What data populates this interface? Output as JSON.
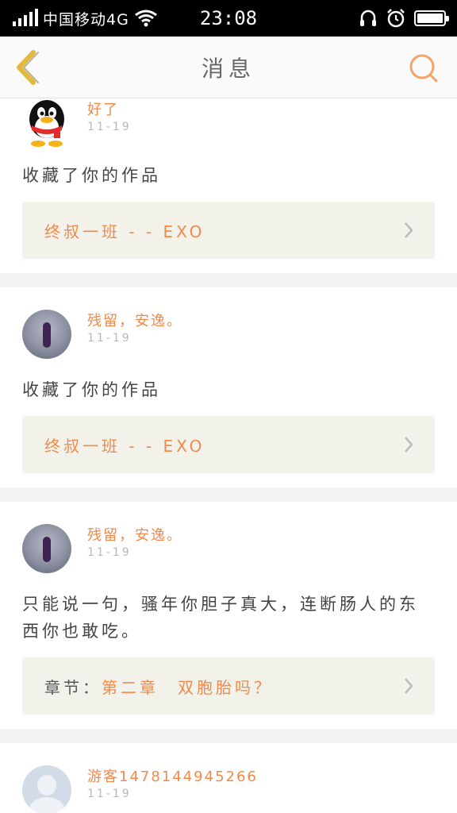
{
  "status_bar": {
    "carrier": "中国移动4G",
    "time": "23:08"
  },
  "nav": {
    "title": "消息"
  },
  "colors": {
    "accent": "#f08a4b",
    "back": "#e2b93a",
    "search": "#f3a46a"
  },
  "messages": [
    {
      "username": "好了",
      "date": "11-19",
      "text": "收藏了你的作品",
      "work_title": "终叔一班 - - EXO",
      "avatar": "qq-penguin-icon"
    },
    {
      "username": "残留，安逸。",
      "date": "11-19",
      "text": "收藏了你的作品",
      "work_title": "终叔一班 - - EXO",
      "avatar": "photo"
    },
    {
      "username": "残留，安逸。",
      "date": "11-19",
      "text": "只能说一句，骚年你胆子真大，连断肠人的东西你也敢吃。",
      "chapter_label": "章节：",
      "work_title": "第二章　双胞胎吗？",
      "avatar": "photo"
    },
    {
      "username": "游客1478144945266",
      "date": "11-19",
      "avatar": "default-user-icon"
    }
  ]
}
